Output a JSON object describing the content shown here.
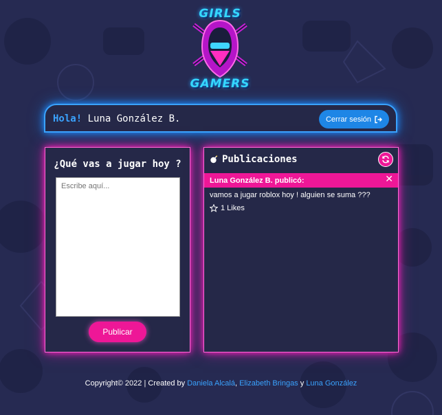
{
  "logo": {
    "top_text": "GIRLS",
    "bottom_text": "GAMERS"
  },
  "header": {
    "greeting": "Hola!",
    "user_name": "Luna González B.",
    "logout_label": "Cerrar sesión"
  },
  "composer": {
    "title": "¿Qué vas a jugar hoy ?",
    "placeholder": "Escribe aquí...",
    "publish_label": "Publicar"
  },
  "feed": {
    "title": "Publicaciones",
    "posts": [
      {
        "author_line": "Luna González B. publicó:",
        "body": "vamos a jugar roblox hoy ! alguien se suma ???",
        "likes": "1 Likes"
      }
    ]
  },
  "footer": {
    "prefix": "Copyright© 2022 | Created by",
    "author1": "Daniela Alcalá",
    "sep1": ",",
    "author2": "Elizabeth Bringas",
    "sep2": "y",
    "author3": "Luna González"
  },
  "colors": {
    "background": "#262a52",
    "accent_blue": "#3aa3ff",
    "accent_pink": "#ee1797",
    "panel": "#252848"
  },
  "icons": {
    "logout": "sign-out-icon",
    "bomb": "bomb-icon",
    "refresh": "refresh-icon",
    "close": "close-icon",
    "star": "star-outline-icon"
  }
}
